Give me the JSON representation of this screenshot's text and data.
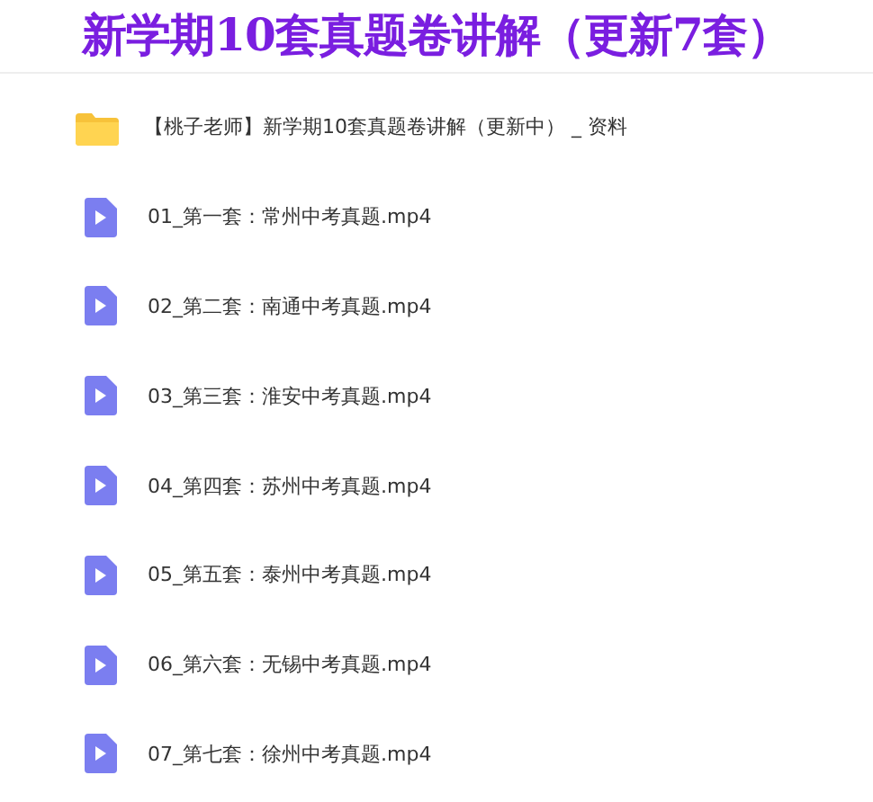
{
  "title": "新学期10套真题卷讲解（更新7套）",
  "files": [
    {
      "kind": "folder",
      "name": "【桃子老师】新学期10套真题卷讲解（更新中） _ 资料"
    },
    {
      "kind": "video",
      "name": "01_第一套：常州中考真题.mp4"
    },
    {
      "kind": "video",
      "name": "02_第二套：南通中考真题.mp4"
    },
    {
      "kind": "video",
      "name": "03_第三套：淮安中考真题.mp4"
    },
    {
      "kind": "video",
      "name": "04_第四套：苏州中考真题.mp4"
    },
    {
      "kind": "video",
      "name": "05_第五套：泰州中考真题.mp4"
    },
    {
      "kind": "video",
      "name": "06_第六套：无锡中考真题.mp4"
    },
    {
      "kind": "video",
      "name": "07_第七套：徐州中考真题.mp4"
    }
  ]
}
